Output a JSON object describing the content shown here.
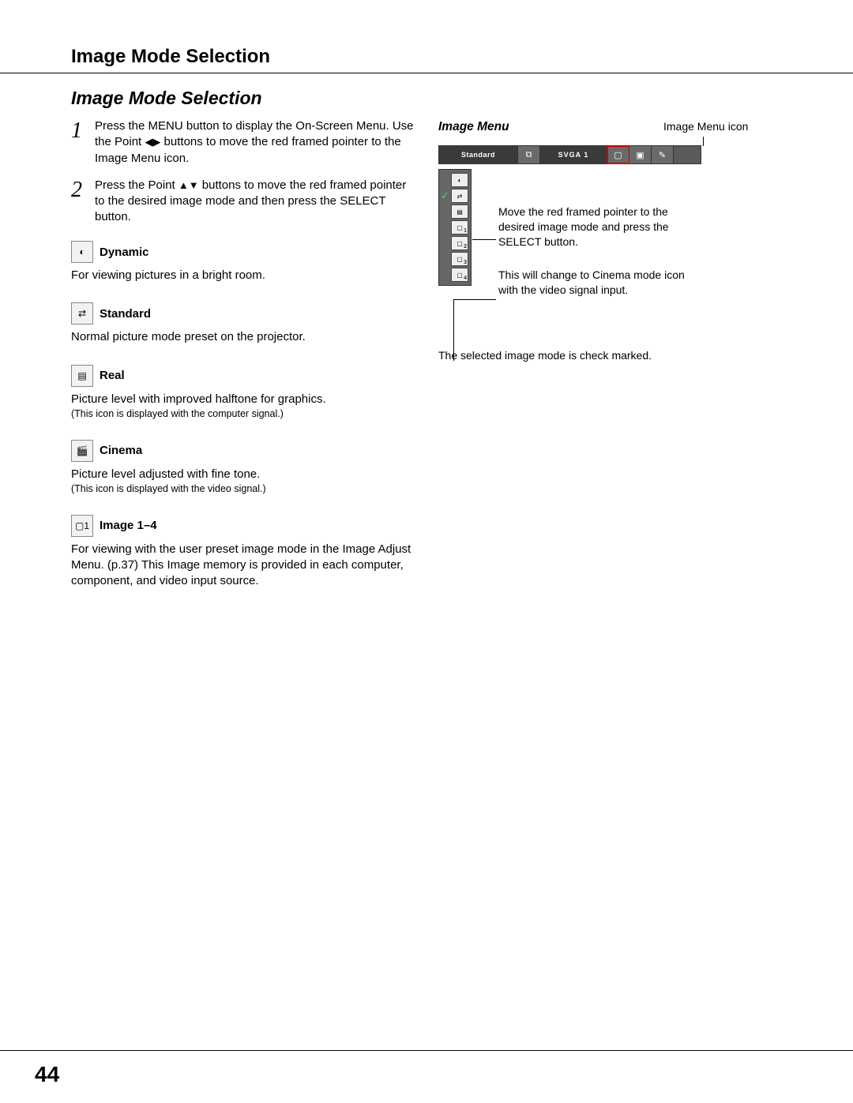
{
  "header": "Image Mode Selection",
  "section_title": "Image Mode Selection",
  "steps": [
    {
      "num": "1",
      "text_a": "Press the MENU button to display the On-Screen Menu. Use the Point ",
      "arrows": "◀▶",
      "text_b": " buttons to move the red framed pointer to the Image Menu icon."
    },
    {
      "num": "2",
      "text_a": "Press the Point ",
      "arrows": "▲▼",
      "text_b": " buttons to move the red framed pointer to the desired image mode and then press the SELECT button."
    }
  ],
  "modes": [
    {
      "icon": "dynamic-icon",
      "glyph": "◐",
      "label": "Dynamic",
      "desc": "For viewing pictures in a bright room.",
      "note": ""
    },
    {
      "icon": "standard-icon",
      "glyph": "⇄",
      "label": "Standard",
      "desc": "Normal picture mode preset on the projector.",
      "note": ""
    },
    {
      "icon": "real-icon",
      "glyph": "▤",
      "label": "Real",
      "desc": "Picture level with improved halftone for graphics.",
      "note": "(This icon is displayed with the computer signal.)"
    },
    {
      "icon": "cinema-icon",
      "glyph": "🎬",
      "label": "Cinema",
      "desc": "Picture level adjusted with fine tone.",
      "note": "(This icon is displayed with the video signal.)"
    },
    {
      "icon": "image1-icon",
      "glyph": "▢1",
      "label": "Image 1–4",
      "desc": "For viewing with the user preset image mode in the Image Adjust Menu. (p.37) This Image memory is provided in each computer, component, and video input source.",
      "note": ""
    }
  ],
  "right": {
    "title": "Image Menu",
    "icon_label": "Image Menu icon",
    "menubar": {
      "name": "Standard",
      "signal": "SVGA 1"
    },
    "annot1": "Move the red framed pointer to the desired image mode and press the SELECT button.",
    "annot2": "This will change to Cinema mode icon with the video signal input.",
    "caption": "The selected image mode is check marked."
  },
  "page_number": "44"
}
